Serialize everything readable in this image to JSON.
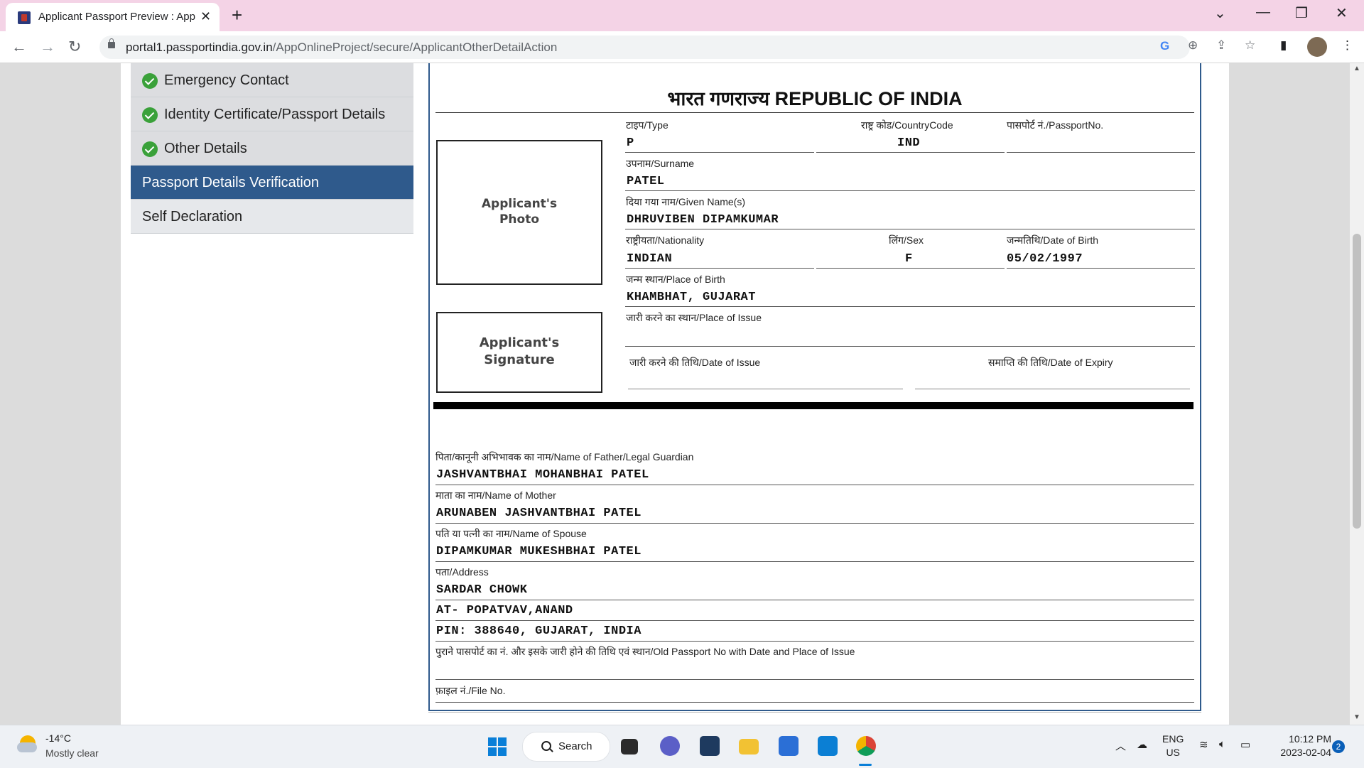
{
  "browser": {
    "tab_title": "Applicant Passport Preview : Application",
    "tab_close": "✕",
    "new_tab": "+",
    "url_host": "portal1.passportindia.gov.in",
    "url_path": "/AppOnlineProject/secure/ApplicantOtherDetailAction",
    "icons": [
      "back-icon",
      "forward-icon",
      "reload-icon",
      "lock-icon",
      "google-icon",
      "zoom-icon",
      "share-icon",
      "star-icon",
      "sidepanel-icon",
      "profile-avatar",
      "menu-icon"
    ]
  },
  "sidebar": {
    "items": [
      {
        "label": "Emergency Contact",
        "status": "complete"
      },
      {
        "label": "Identity Certificate/Passport Details",
        "status": "complete"
      },
      {
        "label": "Other Details",
        "status": "complete"
      },
      {
        "label": "Passport Details Verification",
        "status": "active"
      },
      {
        "label": "Self Declaration",
        "status": "pending"
      }
    ]
  },
  "passport": {
    "title": "भारत गणराज्य   REPUBLIC OF INDIA",
    "photo_label": [
      "Applicant's",
      "Photo"
    ],
    "signature_label": [
      "Applicant's",
      "Signature"
    ],
    "type_label": "टाइप/Type",
    "type_value": "P",
    "country_code_label": "राष्ट्र कोड/CountryCode",
    "country_code_value": "IND",
    "passport_no_label": "पासपोर्ट नं./PassportNo.",
    "passport_no_value": "",
    "surname_label": "उपनाम/Surname",
    "surname_value": "PATEL",
    "given_name_label": "दिया गया नाम/Given Name(s)",
    "given_name_value": "DHRUVIBEN DIPAMKUMAR",
    "nationality_label": "राष्ट्रीयता/Nationality",
    "nationality_value": "INDIAN",
    "sex_label": "लिंग/Sex",
    "sex_value": "F",
    "dob_label": "जन्मतिथि/Date of Birth",
    "dob_value": "05/02/1997",
    "pob_label": "जन्म स्थान/Place of Birth",
    "pob_value": "KHAMBHAT, GUJARAT",
    "poi_label": "जारी करने का स्थान/Place of Issue",
    "poi_value": "",
    "doi_label": "जारी करने की तिथि/Date of Issue",
    "doe_label": "समाप्ति की तिथि/Date of Expiry",
    "father_label": "पिता/कानूनी अभिभावक का नाम/Name of Father/Legal Guardian",
    "father_value": "JASHVANTBHAI MOHANBHAI PATEL",
    "mother_label": "माता का नाम/Name of Mother",
    "mother_value": "ARUNABEN JASHVANTBHAI PATEL",
    "spouse_label": "पति या पत्नी का नाम/Name of Spouse",
    "spouse_value": "DIPAMKUMAR MUKESHBHAI PATEL",
    "address_label": "पता/Address",
    "address_lines": [
      "SARDAR CHOWK",
      "AT- POPATVAV,ANAND",
      "PIN: 388640, GUJARAT, INDIA"
    ],
    "old_passport_label": "पुराने पासपोर्ट का नं. और इसके जारी होने की तिथि एवं स्थान/Old Passport No with Date and Place of Issue",
    "file_no_label": "फ़ाइल नं./File No."
  },
  "taskbar": {
    "weather_temp": "-14°C",
    "weather_desc": "Mostly clear",
    "search_label": "Search",
    "lang_top": "ENG",
    "lang_bottom": "US",
    "time": "10:12 PM",
    "date": "2023-02-04",
    "notification_count": "2"
  }
}
